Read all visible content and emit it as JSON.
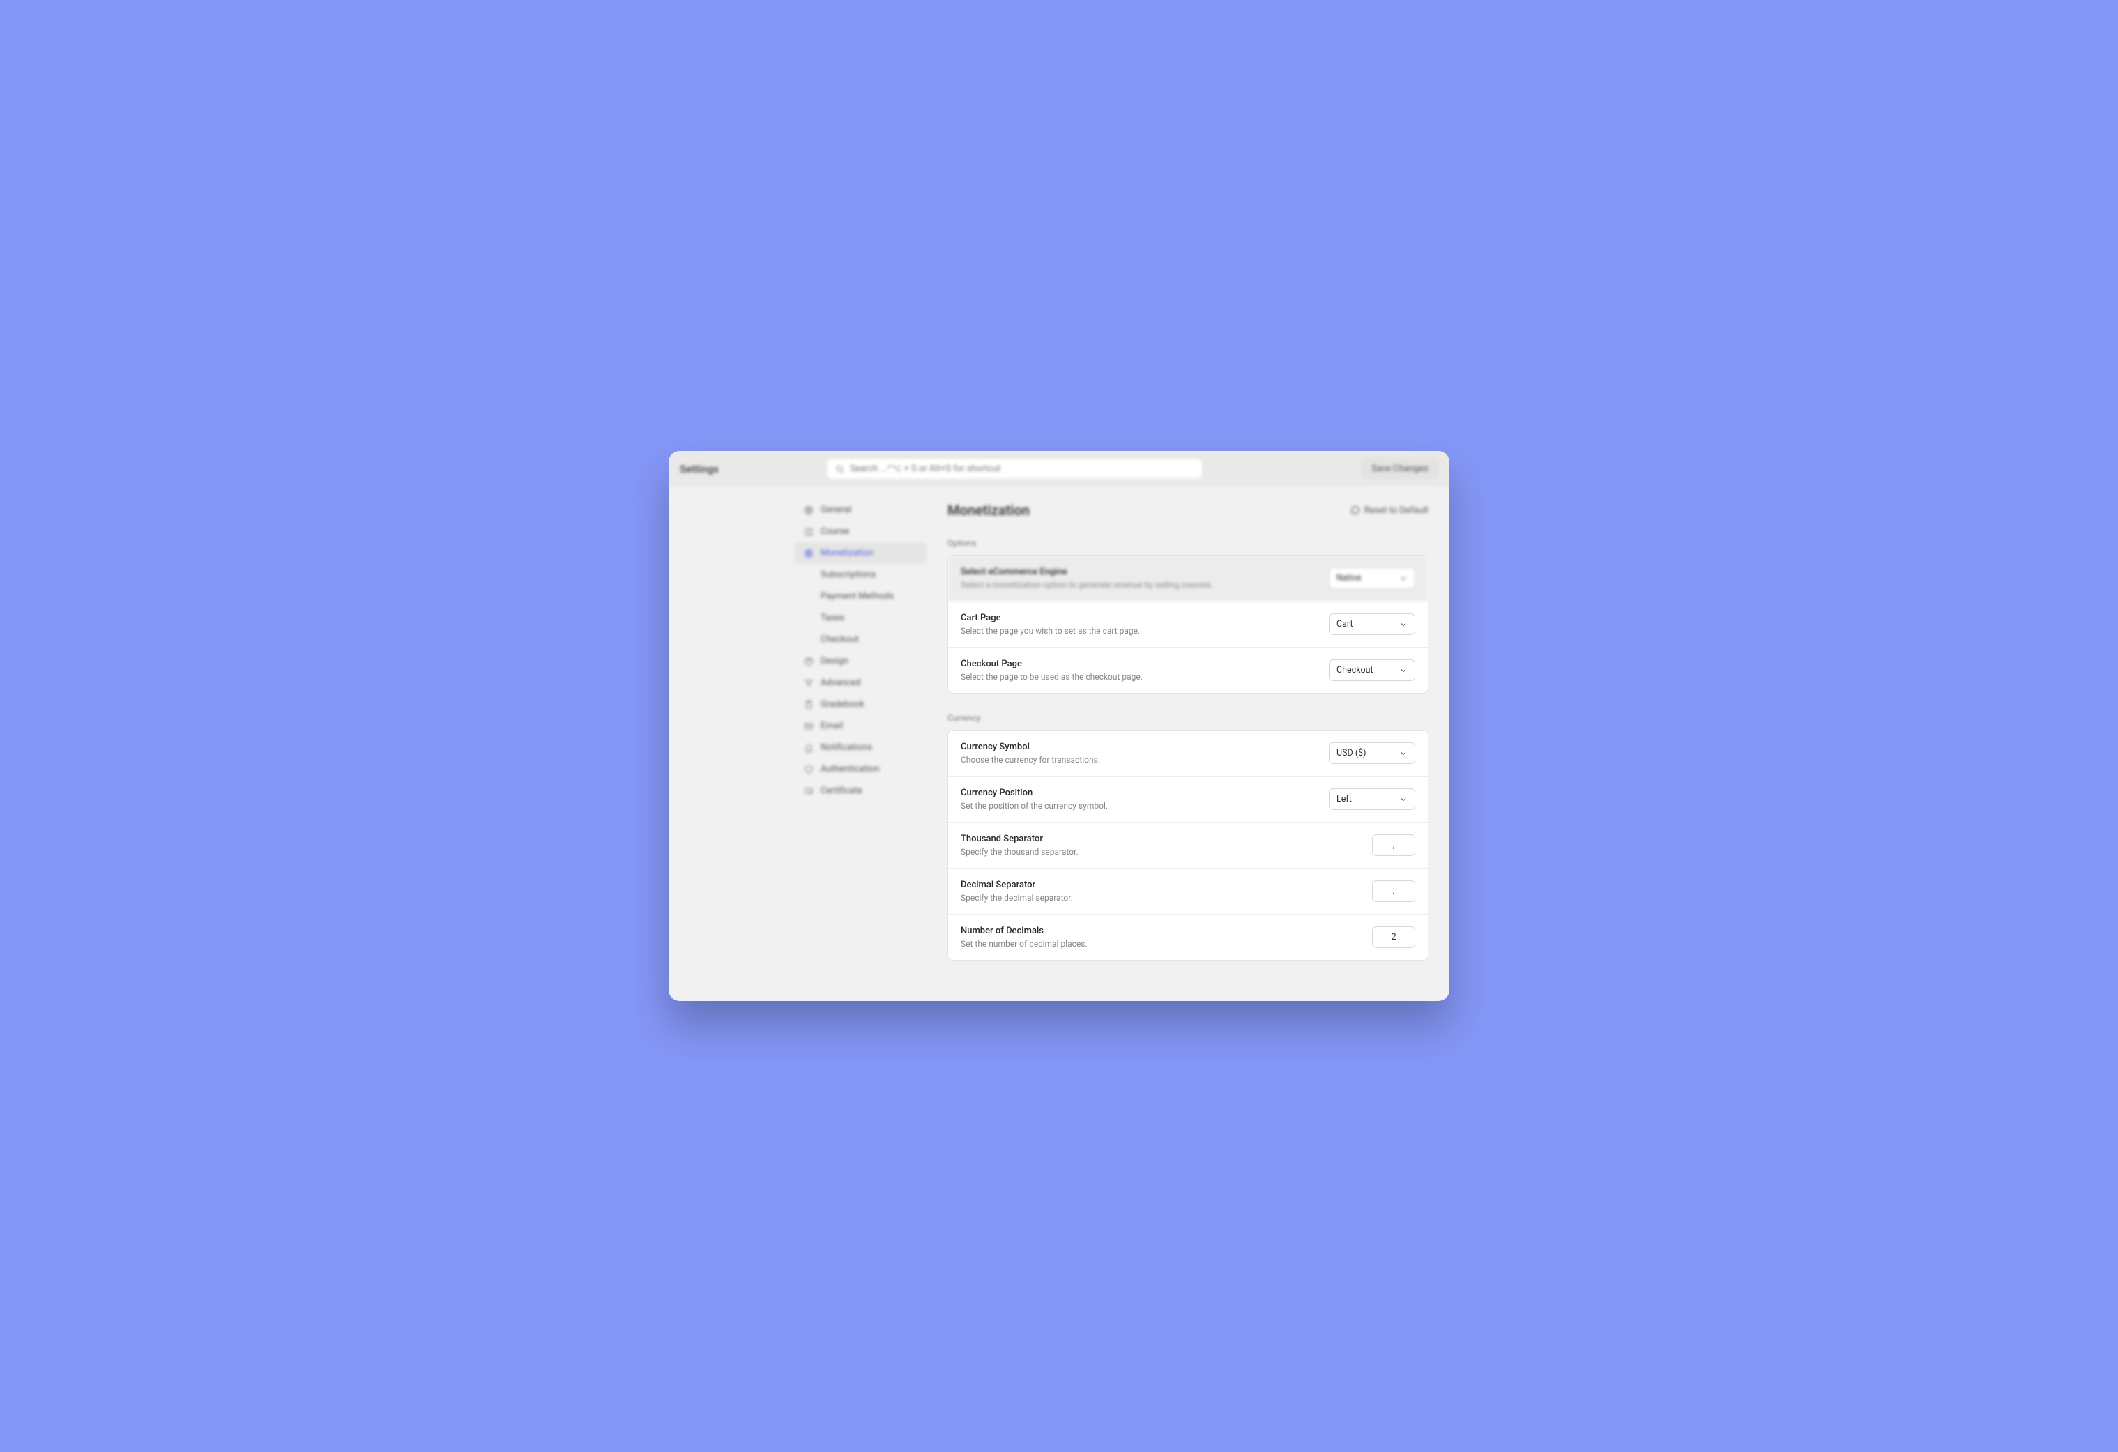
{
  "header": {
    "title": "Settings",
    "search_placeholder": "Search ...^⌥ + S or Alt+S for shortcut",
    "save_label": "Save Changes"
  },
  "sidebar": {
    "items": [
      {
        "label": "General"
      },
      {
        "label": "Course"
      },
      {
        "label": "Monetization",
        "active": true
      },
      {
        "label": "Design"
      },
      {
        "label": "Advanced"
      },
      {
        "label": "Gradebook"
      },
      {
        "label": "Email"
      },
      {
        "label": "Notifications"
      },
      {
        "label": "Authentication"
      },
      {
        "label": "Certificate"
      }
    ],
    "monetization_sub": [
      {
        "label": "Subscriptions"
      },
      {
        "label": "Payment Methods"
      },
      {
        "label": "Taxes"
      },
      {
        "label": "Checkout"
      }
    ]
  },
  "page": {
    "title": "Monetization",
    "reset_label": "Reset to Default",
    "sections": {
      "options_label": "Options",
      "currency_label": "Currency"
    }
  },
  "options": {
    "engine": {
      "title": "Select eCommerce Engine",
      "desc": "Select a monetization option to generate revenue by selling courses.",
      "value": "Native"
    },
    "cart": {
      "title": "Cart Page",
      "desc": "Select the page you wish to set as the cart page.",
      "value": "Cart"
    },
    "checkout": {
      "title": "Checkout Page",
      "desc": "Select the page to be used as the checkout page.",
      "value": "Checkout"
    }
  },
  "currency": {
    "symbol": {
      "title": "Currency Symbol",
      "desc": "Choose the currency for transactions.",
      "value": "USD ($)"
    },
    "position": {
      "title": "Currency Position",
      "desc": "Set the position of the currency symbol.",
      "value": "Left"
    },
    "thousand": {
      "title": "Thousand Separator",
      "desc": "Specify the thousand separator.",
      "value": ","
    },
    "decimal": {
      "title": "Decimal Separator",
      "desc": "Specify the decimal separator.",
      "value": "."
    },
    "decimals": {
      "title": "Number of Decimals",
      "desc": "Set the number of decimal places.",
      "value": "2"
    }
  }
}
